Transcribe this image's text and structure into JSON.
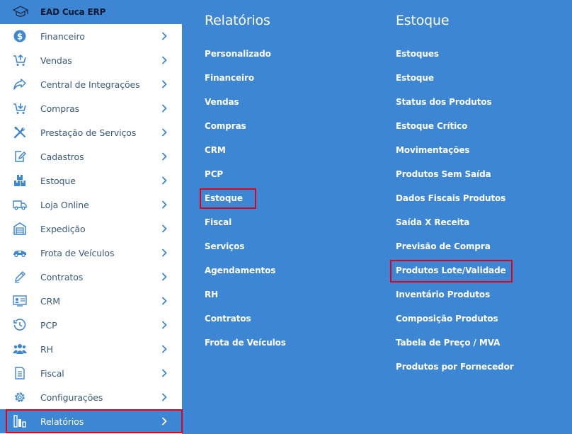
{
  "brand": {
    "name": "EAD Cuca ERP"
  },
  "sidebar": {
    "items": [
      {
        "label": "Financeiro",
        "icon": "dollar-icon"
      },
      {
        "label": "Vendas",
        "icon": "cart-up-icon"
      },
      {
        "label": "Central de Integrações",
        "icon": "share-arrow-icon"
      },
      {
        "label": "Compras",
        "icon": "cart-down-icon"
      },
      {
        "label": "Prestação de Serviços",
        "icon": "tools-icon"
      },
      {
        "label": "Cadastros",
        "icon": "edit-icon"
      },
      {
        "label": "Estoque",
        "icon": "boxes-icon"
      },
      {
        "label": "Loja Online",
        "icon": "truck-icon"
      },
      {
        "label": "Expedição",
        "icon": "warehouse-icon"
      },
      {
        "label": "Frota de Veículos",
        "icon": "car-icon"
      },
      {
        "label": "Contratos",
        "icon": "pen-icon"
      },
      {
        "label": "CRM",
        "icon": "id-card-icon"
      },
      {
        "label": "PCP",
        "icon": "clock-icon"
      },
      {
        "label": "RH",
        "icon": "users-icon"
      },
      {
        "label": "Fiscal",
        "icon": "document-icon"
      },
      {
        "label": "Configurações",
        "icon": "gear-icon"
      },
      {
        "label": "Relatórios",
        "icon": "bar-chart-icon"
      }
    ],
    "active_item": "Relatórios"
  },
  "relatorios": {
    "title": "Relatórios",
    "items": [
      "Personalizado",
      "Financeiro",
      "Vendas",
      "Compras",
      "CRM",
      "PCP",
      "Estoque",
      "Fiscal",
      "Serviços",
      "Agendamentos",
      "RH",
      "Contratos",
      "Frota de Veículos"
    ]
  },
  "estoque": {
    "title": "Estoque",
    "items": [
      "Estoques",
      "Estoque",
      "Status dos Produtos",
      "Estoque Crítico",
      "Movimentações",
      "Produtos Sem Saída",
      "Dados Fiscais Produtos",
      "Saída X Receita",
      "Previsão de Compra",
      "Produtos Lote/Validade",
      "Inventário Produtos",
      "Composição Produtos",
      "Tabela de Preço / MVA",
      "Produtos por Fornecedor"
    ]
  },
  "colors": {
    "accent": "#3d86d4",
    "highlight": "#e0001a",
    "icon": "#3d86d4",
    "sidebar_text": "#3b5a7a"
  }
}
